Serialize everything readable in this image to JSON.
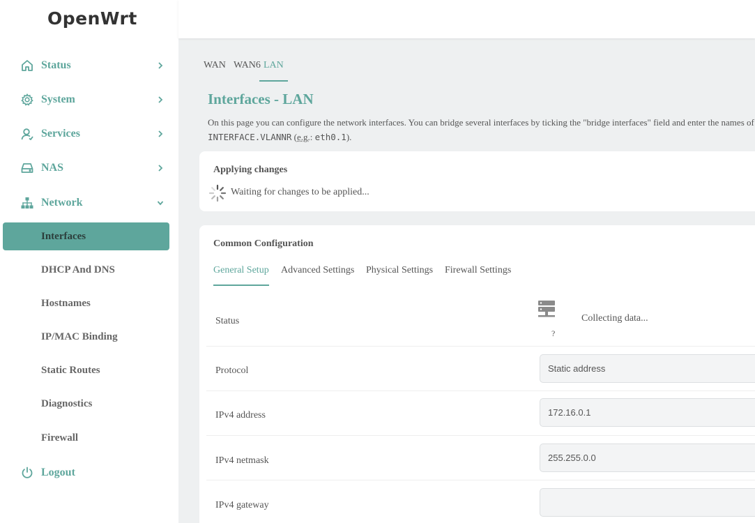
{
  "brand": "OpenWrt",
  "colors": {
    "accent": "#5ea69c",
    "sidebar_bg": "#ffffff",
    "page_bg": "#eef0f1"
  },
  "sidebar": {
    "items": [
      {
        "label": "Status",
        "icon": "home-icon"
      },
      {
        "label": "System",
        "icon": "gear-icon"
      },
      {
        "label": "Services",
        "icon": "user-icon"
      },
      {
        "label": "NAS",
        "icon": "drive-icon"
      },
      {
        "label": "Network",
        "icon": "sitemap-icon"
      },
      {
        "label": "Logout",
        "icon": "power-icon"
      }
    ],
    "network_sub": [
      {
        "label": "Interfaces",
        "active": true
      },
      {
        "label": "DHCP And DNS"
      },
      {
        "label": "Hostnames"
      },
      {
        "label": "IP/MAC Binding"
      },
      {
        "label": "Static Routes"
      },
      {
        "label": "Diagnostics"
      },
      {
        "label": "Firewall"
      }
    ]
  },
  "interface_tabs": [
    {
      "label": "WAN"
    },
    {
      "label": "WAN6"
    },
    {
      "label": "LAN",
      "active": true
    }
  ],
  "page": {
    "title": "Interfaces - LAN",
    "desc_line1": "On this page you can configure the network interfaces. You can bridge several interfaces by ticking the \"bridge interfaces\" field and enter the names of several network interfaces separated by spaces. You can also use VLAN notation",
    "desc_code1": "INTERFACE.VLANNR",
    "desc_open": " (",
    "desc_abbr": "e.g.",
    "desc_colon": ": ",
    "desc_code2": "eth0.1",
    "desc_close": ")."
  },
  "apply": {
    "title": "Applying changes",
    "message": "Waiting for changes to be applied..."
  },
  "common": {
    "title": "Common Configuration",
    "tabs": [
      {
        "label": "General Setup",
        "active": true
      },
      {
        "label": "Advanced Settings"
      },
      {
        "label": "Physical Settings"
      },
      {
        "label": "Firewall Settings"
      }
    ],
    "status": {
      "label": "Status",
      "icon_caption": "?",
      "text": "Collecting data..."
    },
    "fields": [
      {
        "label": "Protocol",
        "value": "Static address"
      },
      {
        "label": "IPv4 address",
        "value": "172.16.0.1"
      },
      {
        "label": "IPv4 netmask",
        "value": "255.255.0.0"
      },
      {
        "label": "IPv4 gateway",
        "value": ""
      }
    ]
  }
}
